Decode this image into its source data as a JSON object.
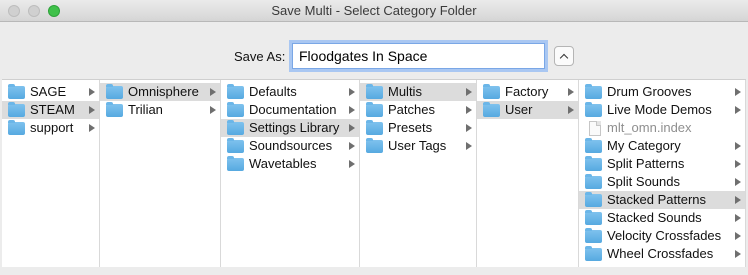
{
  "window": {
    "title": "Save Multi - Select Category Folder"
  },
  "save_as": {
    "label": "Save As:",
    "value": "Floodgates In Space"
  },
  "columns": [
    {
      "items": [
        {
          "label": "SAGE",
          "icon": "folder-icon",
          "arrow": true,
          "selected": false
        },
        {
          "label": "STEAM",
          "icon": "folder-icon",
          "arrow": true,
          "selected": true
        },
        {
          "label": "support",
          "icon": "folder-icon",
          "arrow": true,
          "selected": false
        }
      ]
    },
    {
      "items": [
        {
          "label": "Omnisphere",
          "icon": "folder-icon",
          "arrow": true,
          "selected": true
        },
        {
          "label": "Trilian",
          "icon": "folder-icon",
          "arrow": true,
          "selected": false
        }
      ]
    },
    {
      "items": [
        {
          "label": "Defaults",
          "icon": "folder-icon",
          "arrow": true,
          "selected": false
        },
        {
          "label": "Documentation",
          "icon": "folder-icon",
          "arrow": true,
          "selected": false
        },
        {
          "label": "Settings Library",
          "icon": "folder-icon",
          "arrow": true,
          "selected": true
        },
        {
          "label": "Soundsources",
          "icon": "folder-icon",
          "arrow": true,
          "selected": false
        },
        {
          "label": "Wavetables",
          "icon": "folder-icon",
          "arrow": true,
          "selected": false
        }
      ]
    },
    {
      "items": [
        {
          "label": "Multis",
          "icon": "folder-icon",
          "arrow": true,
          "selected": true
        },
        {
          "label": "Patches",
          "icon": "folder-icon",
          "arrow": true,
          "selected": false
        },
        {
          "label": "Presets",
          "icon": "folder-icon",
          "arrow": true,
          "selected": false
        },
        {
          "label": "User Tags",
          "icon": "folder-icon",
          "arrow": true,
          "selected": false
        }
      ]
    },
    {
      "items": [
        {
          "label": "Factory",
          "icon": "folder-icon",
          "arrow": true,
          "selected": false
        },
        {
          "label": "User",
          "icon": "folder-icon",
          "arrow": true,
          "selected": true
        }
      ]
    },
    {
      "items": [
        {
          "label": "Drum Grooves",
          "icon": "folder-icon",
          "arrow": true,
          "selected": false
        },
        {
          "label": "Live Mode Demos",
          "icon": "folder-icon",
          "arrow": true,
          "selected": false
        },
        {
          "label": "mlt_omn.index",
          "icon": "document-icon",
          "arrow": false,
          "selected": false,
          "dim": true
        },
        {
          "label": "My Category",
          "icon": "folder-icon",
          "arrow": true,
          "selected": false
        },
        {
          "label": "Split Patterns",
          "icon": "folder-icon",
          "arrow": true,
          "selected": false
        },
        {
          "label": "Split Sounds",
          "icon": "folder-icon",
          "arrow": true,
          "selected": false
        },
        {
          "label": "Stacked Patterns",
          "icon": "folder-icon",
          "arrow": true,
          "selected": true
        },
        {
          "label": "Stacked Sounds",
          "icon": "folder-icon",
          "arrow": true,
          "selected": false
        },
        {
          "label": "Velocity Crossfades",
          "icon": "folder-icon",
          "arrow": true,
          "selected": false
        },
        {
          "label": "Wheel Crossfades",
          "icon": "folder-icon",
          "arrow": true,
          "selected": false
        }
      ]
    }
  ]
}
